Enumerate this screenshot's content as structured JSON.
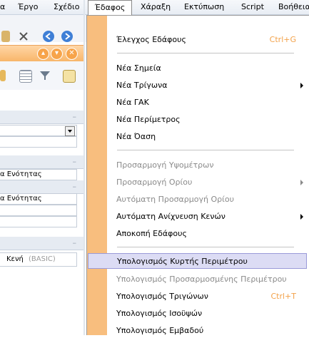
{
  "menubar": {
    "items": [
      {
        "label": "α"
      },
      {
        "label": "Έργο"
      },
      {
        "label": "Σχέδιο"
      },
      {
        "label": "Έδαφος"
      },
      {
        "label": "Χάραξη"
      },
      {
        "label": "Εκτύπωση"
      },
      {
        "label": "Script"
      },
      {
        "label": "Βοήθεια"
      }
    ]
  },
  "left_panel": {
    "rows": [
      {
        "text": "α Ενότητας"
      },
      {
        "text": "α Ενότητας"
      },
      {
        "text": "Κενή"
      },
      {
        "text": "(BASIC)"
      }
    ],
    "section_marker": "–"
  },
  "menu": {
    "items": [
      {
        "label": "Έλεγχος Εδάφους",
        "shortcut": "Ctrl+G",
        "disabled": false,
        "submenu": false
      },
      {
        "label": "Νέα Σημεία",
        "disabled": false,
        "submenu": false
      },
      {
        "label": "Νέα Τρίγωνα",
        "disabled": false,
        "submenu": true
      },
      {
        "label": "Νέα ΓΑΚ",
        "disabled": false,
        "submenu": false
      },
      {
        "label": "Νέα Περίμετρος",
        "disabled": false,
        "submenu": false
      },
      {
        "label": "Νέα Όαση",
        "disabled": false,
        "submenu": false
      },
      {
        "label": "Προσαρμογή Υψομέτρων",
        "disabled": true,
        "submenu": false
      },
      {
        "label": "Προσαρμογή Ορίου",
        "disabled": true,
        "submenu": true
      },
      {
        "label": "Αυτόματη Προσαρμογή Ορίου",
        "disabled": true,
        "submenu": false
      },
      {
        "label": "Αυτόματη Ανίχνευση Κενών",
        "disabled": false,
        "submenu": true
      },
      {
        "label": "Αποκοπή Εδάφους",
        "disabled": false,
        "submenu": false
      },
      {
        "label": "Υπολογισμός Κυρτής Περιμέτρου",
        "disabled": false,
        "highlighted": true
      },
      {
        "label": "Υπολογισμός Προσαρμοσμένης Περιμέτρου",
        "disabled": true
      },
      {
        "label": "Υπολογισμός Τριγώνων",
        "shortcut": "Ctrl+T",
        "disabled": false
      },
      {
        "label": "Υπολογισμός Ισοϋψών",
        "disabled": false
      },
      {
        "label": "Υπολογισμός Εμβαδού",
        "disabled": false
      }
    ]
  },
  "colors": {
    "accent_orange": "#f8be7e",
    "shortcut": "#f3a24a",
    "highlight": "#dcdcf4"
  },
  "icons": [
    "paste-icon",
    "cut-icon",
    "back-icon",
    "forward-icon",
    "minimize-icon",
    "restore-icon",
    "close-icon",
    "dropdown-icon"
  ]
}
